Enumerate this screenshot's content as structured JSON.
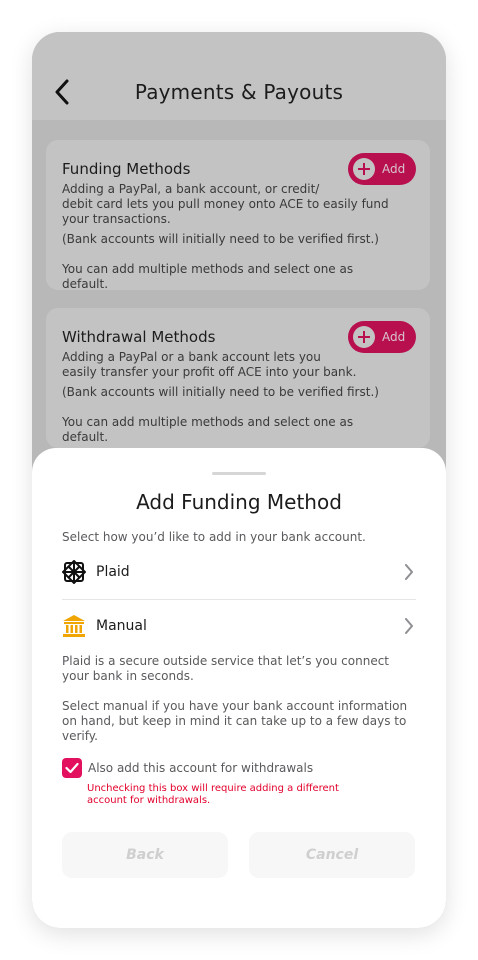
{
  "header": {
    "title": "Payments & Payouts"
  },
  "funding_card": {
    "title": "Funding Methods",
    "add_label": "Add",
    "text_lines": [
      "Adding a PayPal, a bank account, or credit/",
      "debit card lets you pull money onto ACE to easily fund",
      "your transactions."
    ],
    "note": "(Bank accounts will initially need to be verified first.)",
    "multi": "You can add multiple methods and select one as default."
  },
  "withdrawal_card": {
    "title": "Withdrawal Methods",
    "add_label": "Add",
    "text_lines": [
      "Adding a PayPal or a bank account lets you",
      "easily transfer your profit off ACE into your bank."
    ],
    "note": "(Bank accounts will initially need to be verified first.)",
    "multi": "You can add multiple methods and select one as default."
  },
  "sheet": {
    "title": "Add Funding Method",
    "subtitle": "Select how you’d like to add in your bank account.",
    "options": [
      {
        "label": "Plaid",
        "icon": "plaid-icon"
      },
      {
        "label": "Manual",
        "icon": "bank-icon"
      }
    ],
    "plaid_info_lines": [
      "Plaid is a secure outside service that let’s you connect",
      "your bank in seconds."
    ],
    "manual_info_lines": [
      "Select manual if you have your bank account information",
      "on hand, but keep in mind it can take up to a few days to",
      "verify."
    ],
    "checkbox_label": "Also add this account for withdrawals",
    "checkbox_checked": true,
    "warning_lines": [
      "Unchecking this box will require adding a different",
      "account for withdrawals."
    ],
    "back_label": "Back",
    "cancel_label": "Cancel"
  },
  "colors": {
    "accent": "#e2105e",
    "accent_dim": "#b8104f",
    "warning": "#e3002b",
    "plaid_gold": "#f0a500"
  }
}
